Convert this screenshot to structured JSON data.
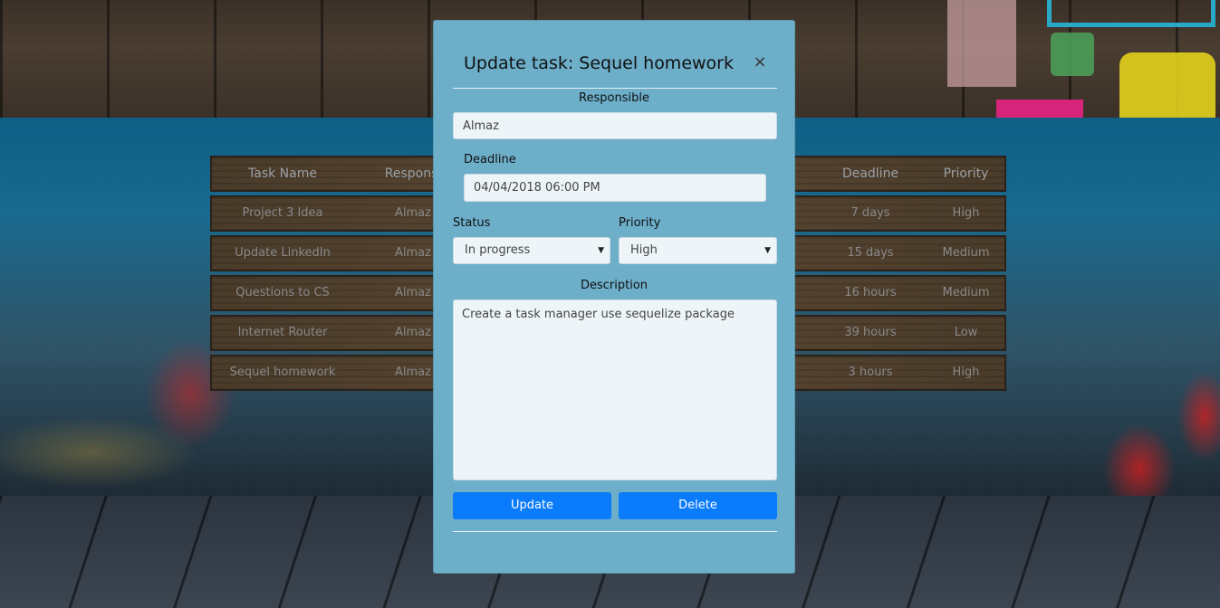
{
  "table": {
    "headers": {
      "name": "Task Name",
      "responsible": "Responsi",
      "deadline": "Deadline",
      "priority": "Priority"
    },
    "rows": [
      {
        "name": "Project 3 Idea",
        "responsible": "Almaz",
        "deadline": "7 days",
        "priority": "High"
      },
      {
        "name": "Update LinkedIn",
        "responsible": "Almaz",
        "deadline": "15 days",
        "priority": "Medium"
      },
      {
        "name": "Questions to CS",
        "responsible": "Almaz",
        "deadline": "16 hours",
        "priority": "Medium"
      },
      {
        "name": "Internet Router",
        "responsible": "Almaz",
        "deadline": "39 hours",
        "priority": "Low"
      },
      {
        "name": "Sequel homework",
        "responsible": "Almaz",
        "deadline": "3 hours",
        "priority": "High"
      }
    ]
  },
  "modal": {
    "title": "Update task: Sequel homework",
    "close_glyph": "×",
    "responsible": {
      "label": "Responsible",
      "value": "Almaz"
    },
    "deadline": {
      "label": "Deadline",
      "value": "04/04/2018 06:00 PM"
    },
    "status": {
      "label": "Status",
      "value": "In progress",
      "caret": "▼"
    },
    "priority": {
      "label": "Priority",
      "value": "High",
      "caret": "▼"
    },
    "description": {
      "label": "Description",
      "value": "Create a task manager use sequelize package"
    },
    "buttons": {
      "update": "Update",
      "delete": "Delete"
    }
  },
  "colors": {
    "modal_bg": "#6daec9",
    "button_bg": "#0a7bfb"
  }
}
